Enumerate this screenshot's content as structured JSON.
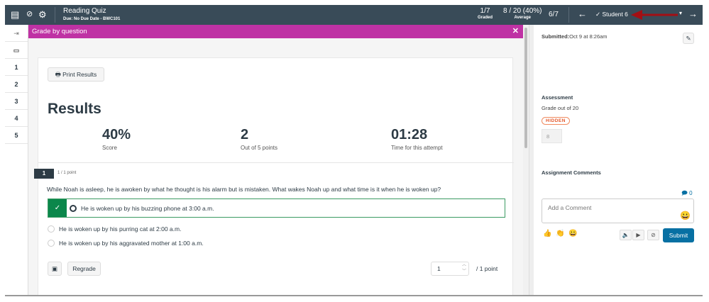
{
  "header": {
    "title": "Reading Quiz",
    "due": "Due: No Due Date - BWC101",
    "graded_value": "1/7",
    "graded_label": "Graded",
    "average_value": "8 / 20 (40%)",
    "average_label": "Average",
    "position": "6/7",
    "student": "Student 6",
    "check": "✓",
    "prev": "←",
    "next": "→",
    "dropdown": "▾"
  },
  "nav": {
    "collapse": "⇥",
    "questions": [
      "1",
      "2",
      "3",
      "4",
      "5"
    ]
  },
  "panel": {
    "title": "Grade by question",
    "close": "✕"
  },
  "results": {
    "print_label": "Print Results",
    "heading": "Results",
    "score_value": "40%",
    "score_label": "Score",
    "points_value": "2",
    "points_label": "Out of 5 points",
    "time_value": "01:28",
    "time_label": "Time for this attempt"
  },
  "question": {
    "number": "1",
    "points": "1 / 1 point",
    "text": "While Noah is asleep, he is awoken by what he thought is his alarm but is mistaken. What wakes Noah up and what time is it when he is woken up?",
    "answers": [
      "He is woken up by his buzzing phone at 3:00 a.m.",
      "He is woken up by his purring cat at 2:00 a.m.",
      "He is woken up by his aggravated mother at 1:00 a.m."
    ],
    "regrade_label": "Regrade",
    "score_input": "1",
    "score_suffix": "/ 1 point"
  },
  "sidebar": {
    "submitted_label": "Submitted:",
    "submitted_value": "Oct 9 at 8:26am",
    "assessment": "Assessment",
    "grade_out_of": "Grade out of 20",
    "hidden_badge": "HIDDEN",
    "grade_value": "8",
    "comments_heading": "Assignment Comments",
    "comment_count": "0",
    "comment_placeholder": "Add a Comment",
    "submit_label": "Submit"
  },
  "colors": {
    "header": "#394b58",
    "magenta": "#bf32a4",
    "correct": "#0b874b",
    "submit": "#0770a3",
    "arrow": "#a30f14"
  }
}
